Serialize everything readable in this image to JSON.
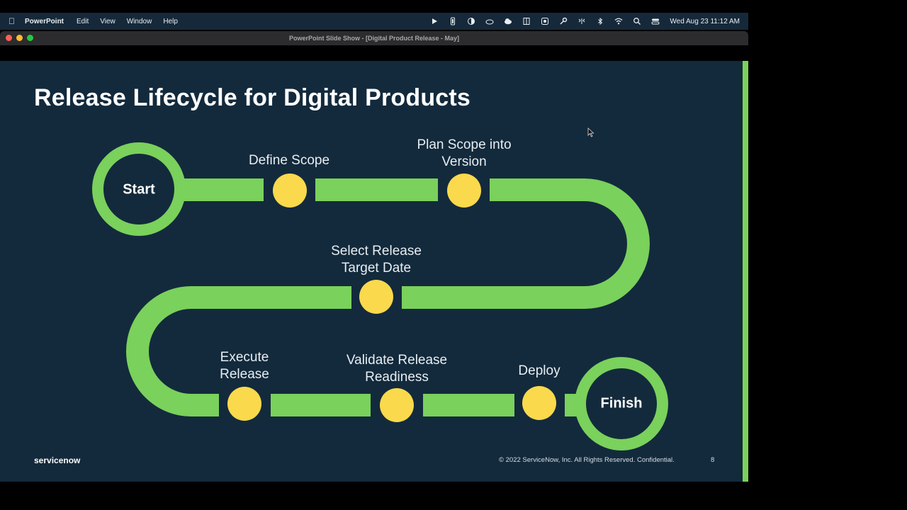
{
  "menubar": {
    "app_name": "PowerPoint",
    "menus": [
      "Edit",
      "View",
      "Window",
      "Help"
    ],
    "status_icons": [
      "play-icon",
      "battery-icon",
      "half-circle-icon",
      "cloud-icon",
      "weather-icon",
      "book-icon",
      "badge-icon",
      "key-icon",
      "network-icon",
      "bluetooth-icon",
      "wifi-icon",
      "search-icon",
      "control-center-icon"
    ],
    "clock": "Wed Aug 23  11:12 AM"
  },
  "window": {
    "title": "PowerPoint Slide Show - [Digital Product Release - May]"
  },
  "slide": {
    "title": "Release Lifecycle for Digital Products",
    "start_label": "Start",
    "finish_label": "Finish",
    "stages": [
      {
        "label_lines": [
          "Define Scope"
        ]
      },
      {
        "label_lines": [
          "Plan Scope into",
          "Version"
        ]
      },
      {
        "label_lines": [
          "Select Release",
          "Target Date"
        ]
      },
      {
        "label_lines": [
          "Execute",
          "Release"
        ]
      },
      {
        "label_lines": [
          "Validate Release",
          "Readiness"
        ]
      },
      {
        "label_lines": [
          "Deploy"
        ]
      }
    ],
    "brand": "servicenow",
    "copyright": "© 2022 ServiceNow, Inc. All Rights Reserved. Confidential.",
    "page_number": "8"
  },
  "colors": {
    "slide_bg": "#132a3c",
    "path_green": "#7ad15c",
    "milestone_yellow": "#fad94c",
    "menubar_bg": "#16293a"
  }
}
